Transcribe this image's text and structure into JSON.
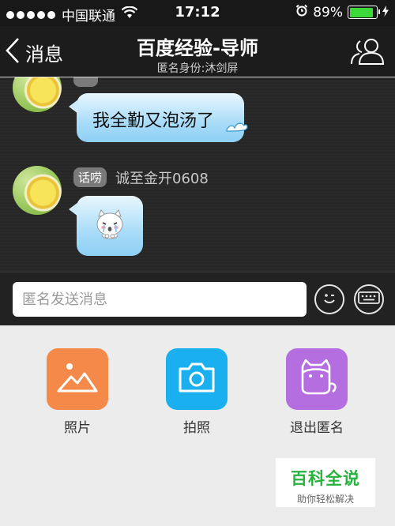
{
  "status_bar": {
    "carrier": "中国联通",
    "time": "17:12",
    "battery_percent": "89%",
    "battery_level": 0.89,
    "battery_color": "#3dd93a"
  },
  "navbar": {
    "back_label": "消息",
    "title": "百度经验-导师",
    "subtitle": "匿名身份:沐剑屏"
  },
  "messages": [
    {
      "badge": "",
      "sender": "",
      "text": "我全勤又泡汤了"
    },
    {
      "badge": "话唠",
      "sender": "诚至金开0608",
      "text": "",
      "sticker": "crying-cat-sticker"
    }
  ],
  "input": {
    "placeholder": "匿名发送消息"
  },
  "actions": [
    {
      "label": "照片",
      "icon": "photo-icon",
      "color": "#f5894a"
    },
    {
      "label": "拍照",
      "icon": "camera-icon",
      "color": "#1ab0ef"
    },
    {
      "label": "退出匿名",
      "icon": "cat-mask-icon",
      "color": "#b56ee0"
    }
  ],
  "watermark": {
    "title": "百科全说",
    "subtitle": "助你轻松解决"
  }
}
